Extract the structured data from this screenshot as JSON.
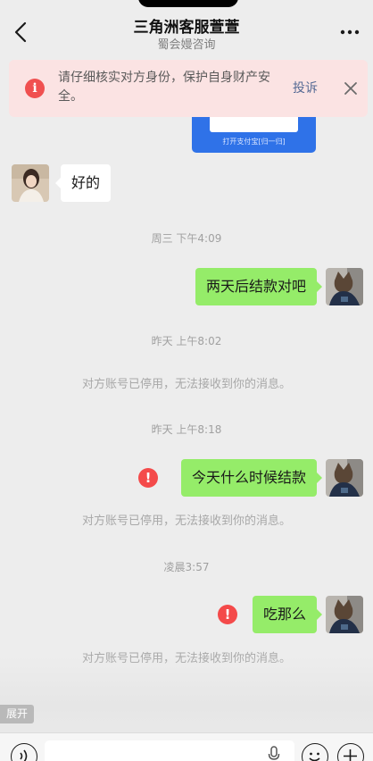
{
  "header": {
    "title": "三角洲客服萱萱",
    "subtitle": "蜀会嫚咨询"
  },
  "warning": {
    "text": "请仔细核实对方身份，保护自身财产安全。",
    "report_label": "投诉"
  },
  "pay_card": {
    "button_label": "打开支付宝[归一归]"
  },
  "messages": [
    {
      "type": "incoming",
      "text": "好的"
    },
    {
      "type": "time",
      "text": "周三 下午4:09"
    },
    {
      "type": "outgoing",
      "text": "两天后结款对吧"
    },
    {
      "type": "time",
      "text": "昨天 上午8:02"
    },
    {
      "type": "system",
      "text": "对方账号已停用，无法接收到你的消息。"
    },
    {
      "type": "time",
      "text": "昨天 上午8:18"
    },
    {
      "type": "outgoing_failed",
      "text": "今天什么时候结款"
    },
    {
      "type": "system",
      "text": "对方账号已停用，无法接收到你的消息。"
    },
    {
      "type": "time",
      "text": "凌晨3:57"
    },
    {
      "type": "outgoing_failed",
      "text": "吃那么"
    },
    {
      "type": "system",
      "text": "对方账号已停用，无法接收到你的消息。"
    }
  ],
  "error_glyph": "!",
  "expand_label": "展开",
  "colors": {
    "outgoing_bubble": "#95ec69",
    "incoming_bubble": "#ffffff",
    "warning_bg": "#fbe3e3",
    "error": "#f44a4a",
    "link": "#576b95"
  },
  "icons": [
    "back-arrow-icon",
    "more-icon",
    "warning-icon",
    "close-icon",
    "error-icon",
    "voice-icon",
    "mic-icon",
    "emoji-icon",
    "plus-icon"
  ]
}
